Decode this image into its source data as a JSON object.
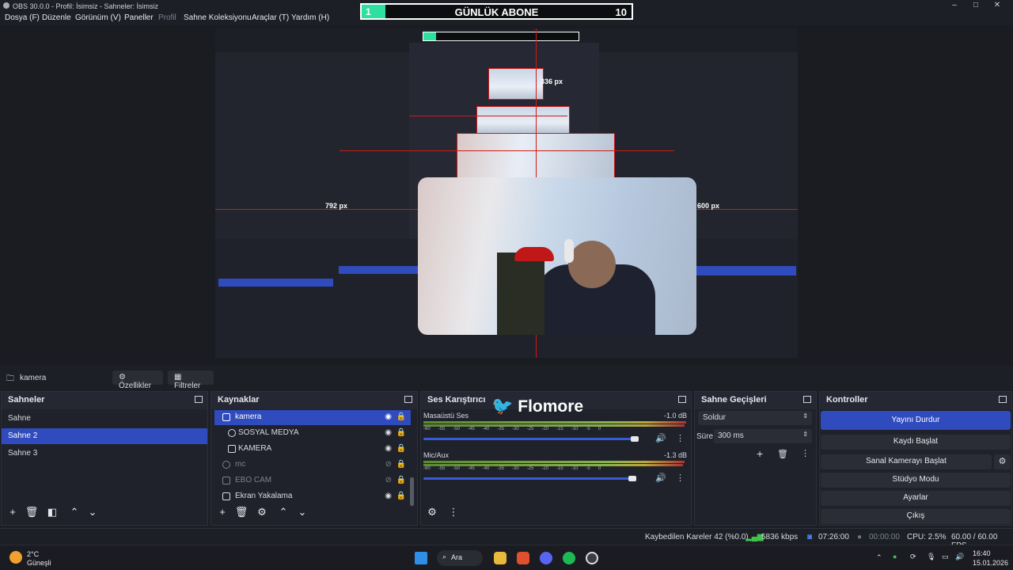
{
  "window": {
    "title": "OBS 30.0.0 - Profil: İsimsiz - Sahneler: İsimsiz"
  },
  "menu": [
    "Dosya (F)",
    "Düzenle",
    "Görünüm (V)",
    "Paneller",
    "Profil",
    "Sahne Koleksiyonu",
    "Araçlar (T)",
    "Yardım (H)"
  ],
  "overlay": {
    "badge": "1",
    "title": "GÜNLÜK ABONE",
    "count": "10"
  },
  "preview": {
    "label_top": "336 px",
    "label_left": "792 px",
    "label_right": "600 px"
  },
  "source_toolbar": {
    "selected": "kamera",
    "properties": "Özellikler",
    "filters": "Filtreler"
  },
  "scenes": {
    "title": "Sahneler",
    "items": [
      "Sahne",
      "Sahne 2",
      "Sahne 3"
    ],
    "selected_index": 1
  },
  "sources": {
    "title": "Kaynaklar",
    "items": [
      {
        "name": "kamera",
        "icon": "folder-icon",
        "selected": true,
        "visible": true,
        "dim": false
      },
      {
        "name": "SOSYAL MEDYA",
        "icon": "browser-icon",
        "selected": false,
        "visible": true,
        "dim": false
      },
      {
        "name": "KAMERA",
        "icon": "camera-icon",
        "selected": false,
        "visible": true,
        "dim": false
      },
      {
        "name": "mc",
        "icon": "mic-icon",
        "selected": false,
        "visible": false,
        "dim": true
      },
      {
        "name": "EBO CAM",
        "icon": "window-icon",
        "selected": false,
        "visible": false,
        "dim": true
      },
      {
        "name": "Ekran Yakalama",
        "icon": "monitor-icon",
        "selected": false,
        "visible": true,
        "dim": false
      }
    ]
  },
  "mixer": {
    "title": "Ses Karıştırıcı",
    "watermark": "Flomore",
    "scale": [
      "-60",
      "-55",
      "-50",
      "-45",
      "-40",
      "-35",
      "-30",
      "-25",
      "-20",
      "-15",
      "-10",
      "-5",
      "0"
    ],
    "channels": [
      {
        "name": "Masaüstü Ses",
        "db": "-1.0 dB",
        "level": 0.96
      },
      {
        "name": "Mic/Aux",
        "db": "-1.3 dB",
        "level": 0.95
      }
    ]
  },
  "transitions": {
    "title": "Sahne Geçişleri",
    "type": "Soldur",
    "duration_label": "Süre",
    "duration": "300 ms"
  },
  "controls": {
    "title": "Kontroller",
    "buttons": [
      "Yayını Durdur",
      "Kaydı Başlat",
      "Sanal Kamerayı Başlat",
      "Stüdyo Modu",
      "Ayarlar",
      "Çıkış"
    ]
  },
  "status": {
    "dropped": "Kaybedilen Kareler 42 (%0.0)",
    "bitrate": "5836 kbps",
    "live_time": "07:26:00",
    "rec_time": "00:00:00",
    "cpu": "CPU: 2.5%",
    "fps": "60.00 / 60.00 FPS"
  },
  "taskbar": {
    "weather_temp": "2°C",
    "weather_label": "Güneşli",
    "search": "Ara",
    "time": "16:40",
    "date": "15.01.2026"
  },
  "colors": {
    "accent": "#2f4bbd",
    "red_guides": "#d01818",
    "overlay_green": "#2ee0a0"
  }
}
